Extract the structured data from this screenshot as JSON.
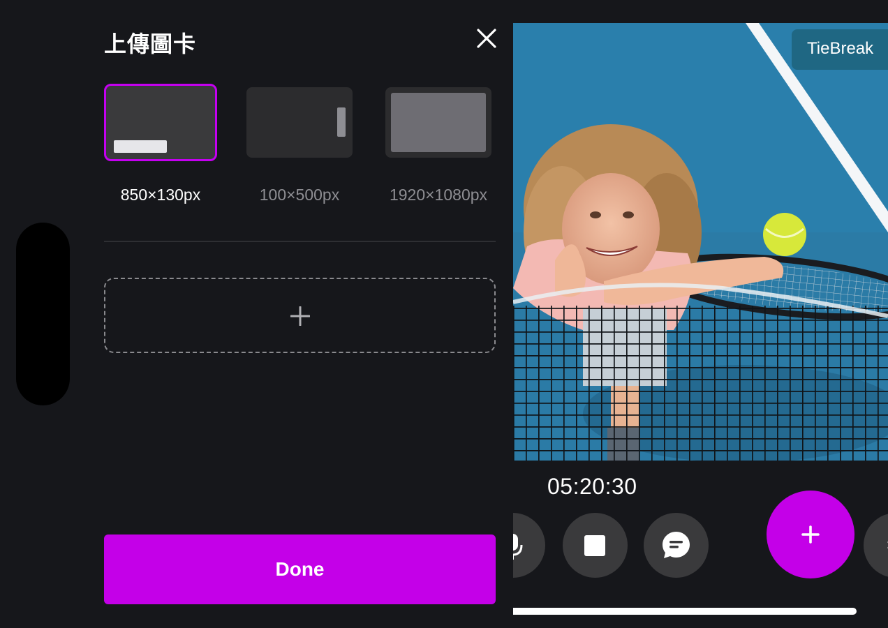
{
  "panel": {
    "title": "上傳圖卡",
    "templates": [
      {
        "label": "850×130px",
        "selected": true
      },
      {
        "label": "100×500px",
        "selected": false
      },
      {
        "label": "1920×1080px",
        "selected": false
      }
    ],
    "done_label": "Done"
  },
  "preview": {
    "badge": "TieBreak",
    "timer": "05:20:30"
  },
  "colors": {
    "accent": "#c400e8",
    "background": "#16171b",
    "control": "#3a3a3c"
  },
  "icons": {
    "close": "close-icon",
    "add": "plus-icon",
    "mic": "microphone-icon",
    "stop": "stop-icon",
    "chat": "chat-bubble-icon",
    "fab": "plus-icon"
  }
}
